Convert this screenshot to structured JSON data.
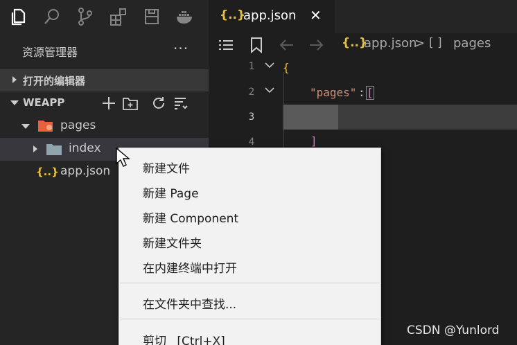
{
  "activity_bar": {
    "icons": [
      "files-icon",
      "search-icon",
      "source-control-icon",
      "extensions-icon",
      "remote-icon",
      "docker-icon"
    ]
  },
  "explorer": {
    "title": "资源管理器",
    "more": "···",
    "open_editors_label": "打开的编辑器",
    "workspace_label": "WEAPP",
    "tree": {
      "pages": "pages",
      "index": "index",
      "app_json_icon": "{..}",
      "app_json": "app.json"
    }
  },
  "editor": {
    "tab": {
      "icon": "{..}",
      "title": "app.json",
      "close": "✕"
    },
    "breadcrumb": {
      "file_icon": "{..}",
      "file": "app.json",
      "separator": ">",
      "array_icon": "[ ]",
      "key": "pages"
    },
    "line_numbers": [
      "1",
      "2",
      "3",
      "4"
    ],
    "code": {
      "line1": "{",
      "line2_key": "\"pages\"",
      "line2_colon": ":",
      "line2_bracket": "[",
      "line4_bracket": "]"
    }
  },
  "context_menu": {
    "items": [
      "新建文件",
      "新建 Page",
      "新建 Component",
      "新建文件夹",
      "在内建终端中打开",
      "在文件夹中查找...",
      "剪切",
      "[Ctrl+X]"
    ]
  },
  "watermark": "CSDN @Yunlord",
  "colors": {
    "json_icon": "#e8c03f",
    "string": "#ce9178",
    "bracket": "#da70d6",
    "folder_pages": "#e8603c",
    "folder_index": "#90a4ae"
  }
}
